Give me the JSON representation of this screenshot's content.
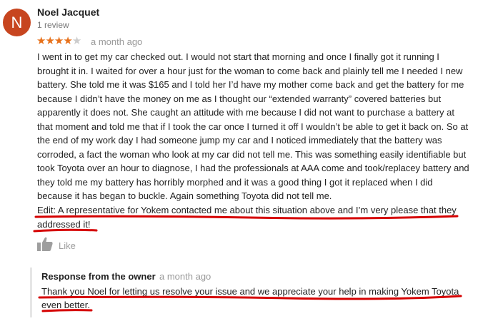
{
  "review": {
    "avatar_letter": "N",
    "author": "Noel Jacquet",
    "review_count": "1 review",
    "rating": 4,
    "rating_max": 5,
    "date": "a month ago",
    "body": "I went in to get my car checked out. I would not start that morning and once I finally got it running I brought it in. I waited for over a hour just for the woman to come back and plainly tell me I needed I new battery. She told me it was $165 and I told her I’d have my mother come back and get the battery for me because I didn’t have the money on me as I thought our “extended warranty” covered batteries but apparently it does not. She caught an attitude with me because I did not want to purchase a battery at that moment and told me that if I took the car once I turned it off I wouldn’t be able to get it back on. So at the end of my work day I had someone jump my car and I noticed immediately that the battery was corroded, a fact the woman who look at my car did not tell me. This was something easily identifiable but took Toyota over an hour to diagnose, I had the professionals at AAA come and took/replacey battery and they told me my battery has horribly morphed and it was a good thing I got it replaced when I did because it has began to buckle. Again something Toyota did not tell me.",
    "edit": "Edit: A representative for Yokem contacted me about this situation above and I’m very please that they addressed it!",
    "like_label": "Like"
  },
  "owner_response": {
    "title": "Response from the owner",
    "date": "a month ago",
    "text": "Thank you Noel for letting us resolve your issue and we appreciate your help in making Yokem Toyota even better."
  },
  "colors": {
    "avatar": "#c7451f",
    "star_filled": "#e7711b",
    "star_empty": "#cccccc",
    "annotation": "#d50000"
  },
  "icons": {
    "like": "thumbs-up-icon"
  }
}
